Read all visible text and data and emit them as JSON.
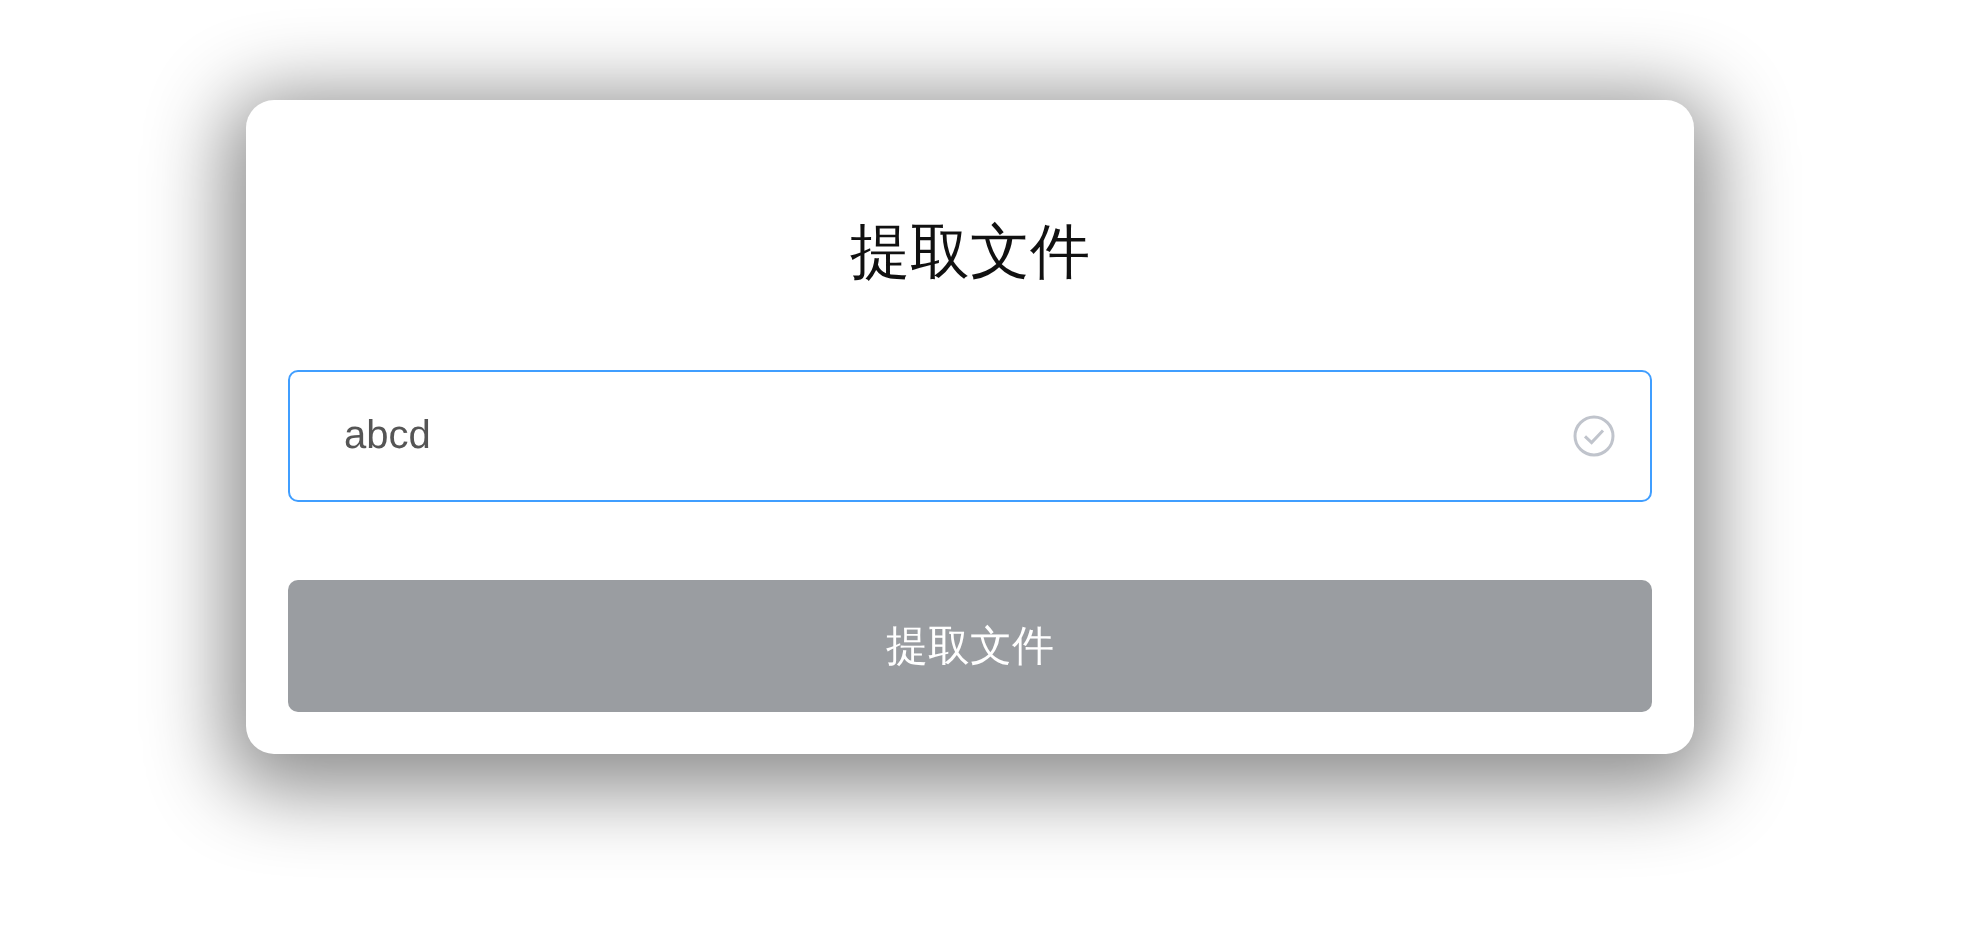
{
  "dialog": {
    "title": "提取文件"
  },
  "code_field": {
    "value": "abcd",
    "focused": true,
    "valid": true
  },
  "submit_button": {
    "label": "提取文件",
    "disabled": true
  }
}
